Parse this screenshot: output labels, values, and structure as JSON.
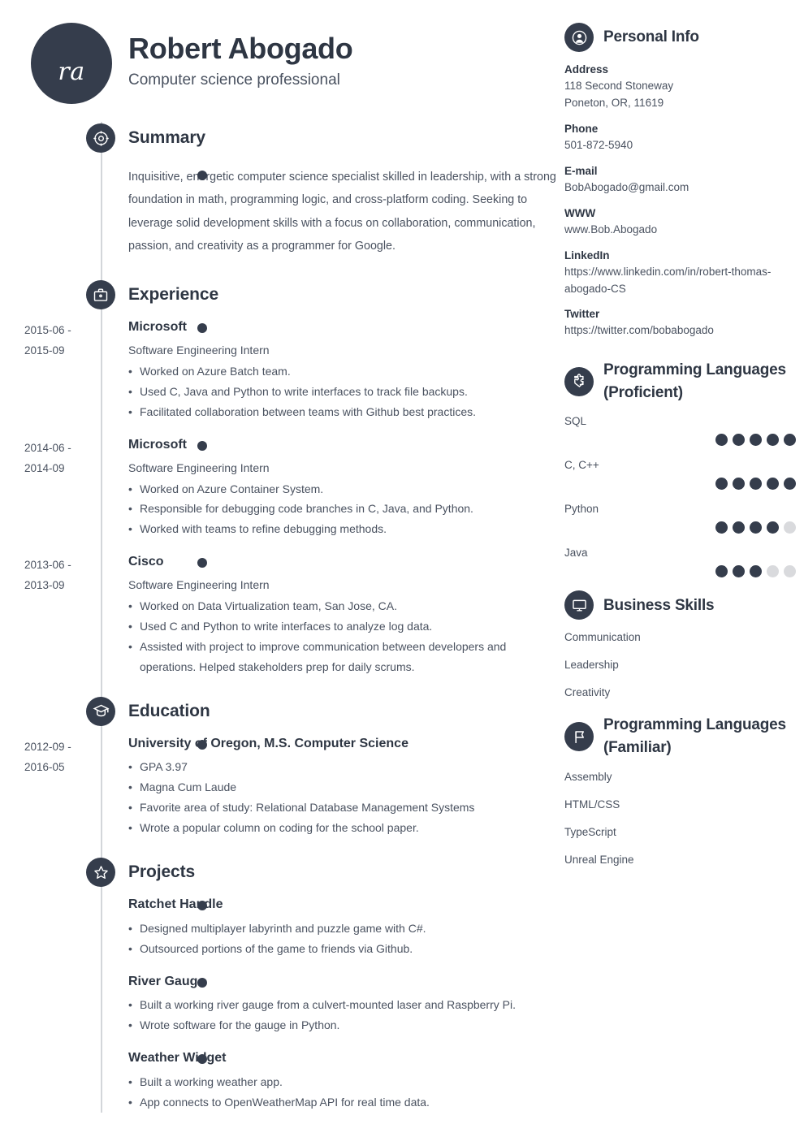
{
  "theme": {
    "dark": "#353d4c",
    "text": "#4a5260",
    "heading": "#2e3643",
    "rail": "#d3d6da",
    "dot_off": "#d9dadd"
  },
  "header": {
    "initials": "ra",
    "name": "Robert Abogado",
    "job_title": "Computer science professional"
  },
  "sections": {
    "summary": {
      "title": "Summary",
      "icon": "target-icon",
      "text": "Inquisitive, energetic computer science specialist skilled in leadership, with a strong foundation in math, programming logic, and cross-platform coding. Seeking to leverage solid development skills with a focus on collaboration, communication, passion, and creativity as a programmer for Google."
    },
    "experience": {
      "title": "Experience",
      "icon": "briefcase-icon",
      "entries": [
        {
          "date_start": "2015-06 -",
          "date_end": "2015-09",
          "title": "Microsoft",
          "subtitle": "Software Engineering Intern",
          "bullets": [
            "Worked on Azure Batch team.",
            "Used C, Java and Python to write interfaces to track file backups.",
            "Facilitated collaboration between teams with Github best practices."
          ]
        },
        {
          "date_start": "2014-06 -",
          "date_end": "2014-09",
          "title": "Microsoft",
          "subtitle": "Software Engineering Intern",
          "bullets": [
            "Worked on Azure Container System.",
            "Responsible for debugging code branches in C, Java, and Python.",
            "Worked with teams to refine debugging methods."
          ]
        },
        {
          "date_start": "2013-06 -",
          "date_end": "2013-09",
          "title": "Cisco",
          "subtitle": "Software Engineering Intern",
          "bullets": [
            "Worked on Data Virtualization team, San Jose, CA.",
            "Used C and Python to write interfaces to analyze log data.",
            "Assisted with project to improve communication between developers and operations. Helped stakeholders prep for daily scrums."
          ]
        }
      ]
    },
    "education": {
      "title": "Education",
      "icon": "graduation-cap-icon",
      "entries": [
        {
          "date_start": "2012-09 -",
          "date_end": "2016-05",
          "title": "University of Oregon, M.S. Computer Science",
          "subtitle": "",
          "bullets": [
            "GPA 3.97",
            "Magna Cum Laude",
            "Favorite area of study: Relational Database Management Systems",
            "Wrote a popular column on coding for the school paper."
          ]
        }
      ]
    },
    "projects": {
      "title": "Projects",
      "icon": "star-icon",
      "entries": [
        {
          "date_start": "",
          "date_end": "",
          "title": "Ratchet Handle",
          "subtitle": "",
          "bullets": [
            "Designed multiplayer labyrinth and puzzle game with C#.",
            "Outsourced portions of the game to friends via Github."
          ]
        },
        {
          "date_start": "",
          "date_end": "",
          "title": "River Gauge",
          "subtitle": "",
          "bullets": [
            "Built a working river gauge from a culvert-mounted laser and Raspberry Pi.",
            "Wrote software for the gauge in Python."
          ]
        },
        {
          "date_start": "",
          "date_end": "",
          "title": "Weather Widget",
          "subtitle": "",
          "bullets": [
            "Built a working weather app.",
            "App connects to OpenWeatherMap API for real time data."
          ]
        }
      ]
    }
  },
  "sidebar": {
    "personal_info": {
      "title": "Personal Info",
      "icon": "person-icon",
      "fields": [
        {
          "label": "Address",
          "value": "118 Second Stoneway\nPoneton, OR, 11619"
        },
        {
          "label": "Phone",
          "value": "501-872-5940"
        },
        {
          "label": "E-mail",
          "value": "BobAbogado@gmail.com"
        },
        {
          "label": "WWW",
          "value": "www.Bob.Abogado"
        },
        {
          "label": "LinkedIn",
          "value": "https://www.linkedin.com/in/robert-thomas-abogado-CS"
        },
        {
          "label": "Twitter",
          "value": "https://twitter.com/bobabogado"
        }
      ]
    },
    "languages_proficient": {
      "title": "Programming Languages (Proficient)",
      "icon": "puzzle-icon",
      "max_rating": 5,
      "skills": [
        {
          "name": "SQL",
          "rating": 5
        },
        {
          "name": "C, C++",
          "rating": 5
        },
        {
          "name": "Python",
          "rating": 4
        },
        {
          "name": "Java",
          "rating": 3
        }
      ]
    },
    "business_skills": {
      "title": "Business Skills",
      "icon": "monitor-icon",
      "items": [
        "Communication",
        "Leadership",
        "Creativity"
      ]
    },
    "languages_familiar": {
      "title": "Programming Languages (Familiar)",
      "icon": "flag-icon",
      "items": [
        "Assembly",
        "HTML/CSS",
        "TypeScript",
        "Unreal Engine"
      ]
    }
  }
}
